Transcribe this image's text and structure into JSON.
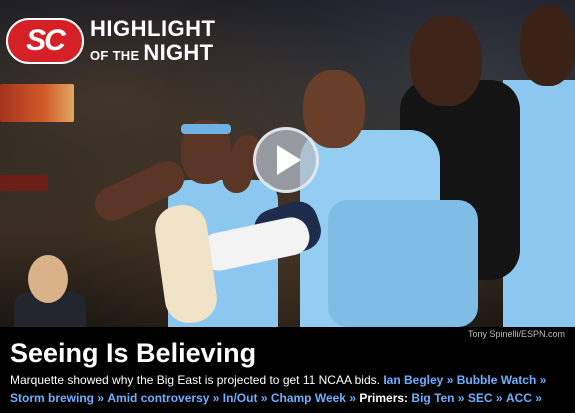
{
  "logo": {
    "badge": "SC",
    "line1": "HIGHLIGHT",
    "line2_small": "OF THE",
    "line2_big": "NIGHT"
  },
  "photo": {
    "credit": "Tony Spinelli/ESPN.com",
    "play_icon": "play-icon"
  },
  "story": {
    "headline": "Seeing Is Believing",
    "summary": "Marquette showed why the Big East is projected to get 11 NCAA bids.",
    "links_line1": [
      "Ian Begley",
      "Bubble Watch"
    ],
    "links_line2": [
      "Storm brewing",
      "Amid controversy",
      "In/Out",
      "Champ Week"
    ],
    "primers_label": "Primers:",
    "primers": [
      "Big Ten",
      "SEC",
      "ACC"
    ],
    "arrow": "»"
  },
  "colors": {
    "link": "#6cb0ff",
    "badge": "#d62027",
    "background": "#000000"
  }
}
